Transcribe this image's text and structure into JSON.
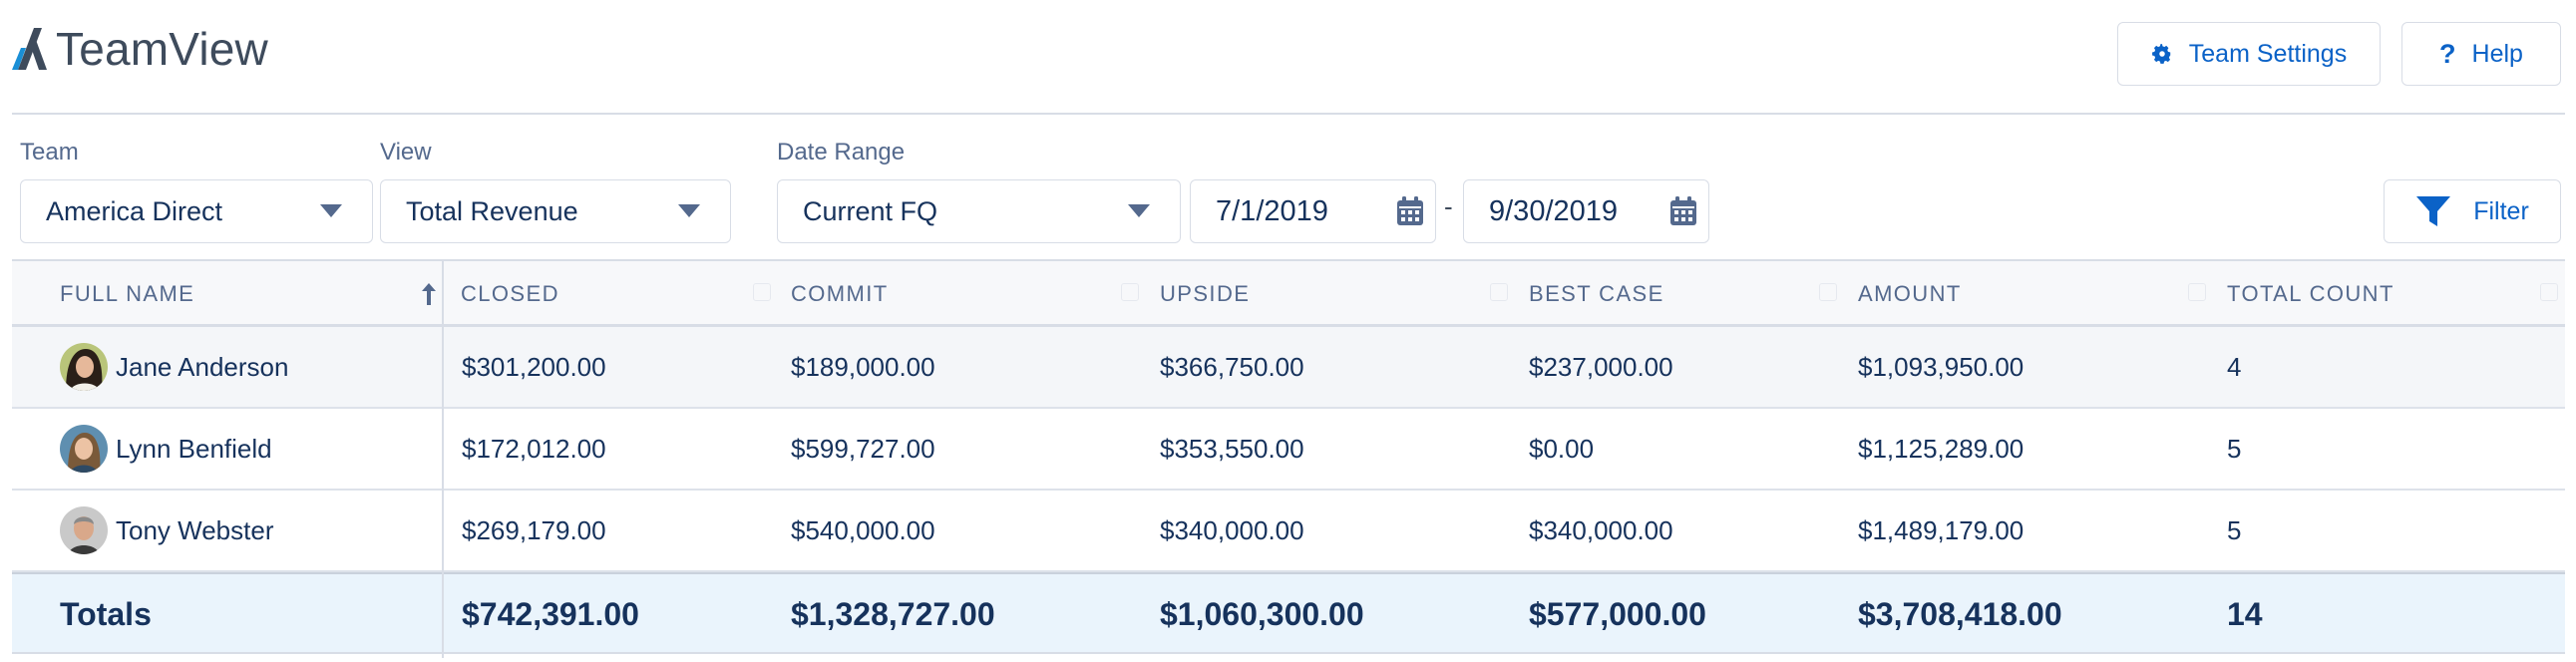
{
  "header": {
    "title": "TeamView",
    "logo_icon": "teamview-logo-icon",
    "settings_label": "Team Settings",
    "settings_icon": "gear-icon",
    "help_label": "Help",
    "help_icon": "question-icon"
  },
  "filters": {
    "team": {
      "label": "Team",
      "value": "America Direct"
    },
    "view": {
      "label": "View",
      "value": "Total Revenue"
    },
    "date_range": {
      "label": "Date Range",
      "value": "Current FQ",
      "start": "7/1/2019",
      "separator": "-",
      "end": "9/30/2019"
    },
    "filter_label": "Filter",
    "filter_icon": "funnel-icon"
  },
  "table": {
    "columns": [
      "Full Name",
      "Closed",
      "Commit",
      "Upside",
      "Best Case",
      "Amount",
      "Total Count"
    ],
    "sort": {
      "column": "Full Name",
      "direction": "ascending"
    },
    "rows": [
      {
        "name": "Jane Anderson",
        "closed": "$301,200.00",
        "commit": "$189,000.00",
        "upside": "$366,750.00",
        "best_case": "$237,000.00",
        "amount": "$1,093,950.00",
        "count": "4"
      },
      {
        "name": "Lynn Benfield",
        "closed": "$172,012.00",
        "commit": "$599,727.00",
        "upside": "$353,550.00",
        "best_case": "$0.00",
        "amount": "$1,125,289.00",
        "count": "5"
      },
      {
        "name": "Tony Webster",
        "closed": "$269,179.00",
        "commit": "$540,000.00",
        "upside": "$340,000.00",
        "best_case": "$340,000.00",
        "amount": "$1,489,179.00",
        "count": "5"
      }
    ],
    "totals": {
      "label": "Totals",
      "closed": "$742,391.00",
      "commit": "$1,328,727.00",
      "upside": "$1,060,300.00",
      "best_case": "$577,000.00",
      "amount": "$3,708,418.00",
      "count": "14"
    }
  },
  "colors": {
    "brand_blue": "#0b62c7",
    "header_text": "#54698d",
    "body_text": "#16325c",
    "totals_bg": "#eaf4fc",
    "border": "#d8dde6"
  }
}
